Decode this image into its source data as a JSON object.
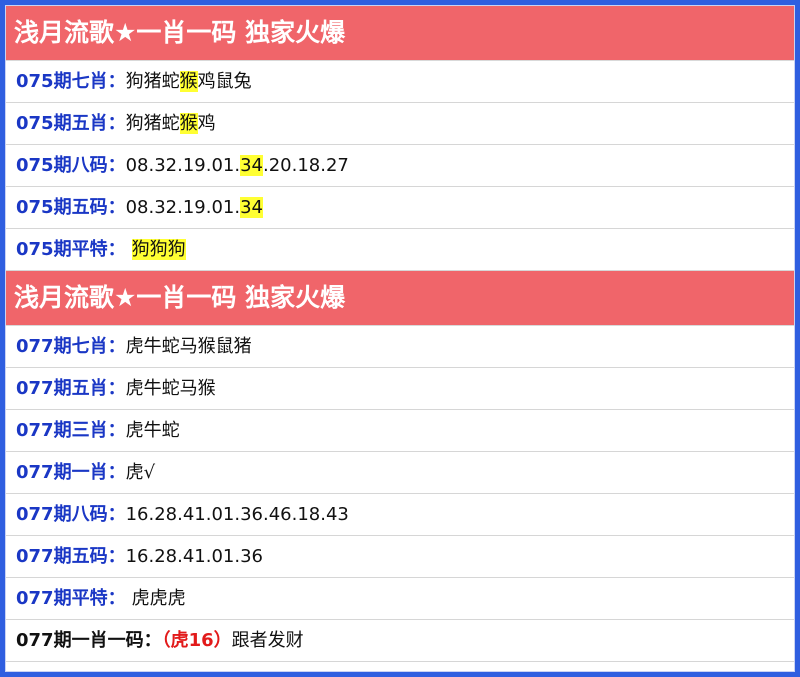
{
  "section1": {
    "header": "浅月流歌★一肖一码 独家火爆",
    "rows": [
      {
        "label": "075期七肖：",
        "pre": "狗猪蛇",
        "hl": "猴",
        "post": "鸡鼠兔"
      },
      {
        "label": "075期五肖：",
        "pre": "狗猪蛇",
        "hl": "猴",
        "post": "鸡"
      },
      {
        "label": "075期八码：",
        "pre": "08.32.19.01.",
        "hl": "34",
        "post": ".20.18.27"
      },
      {
        "label": "075期五码：",
        "pre": "08.32.19.01.",
        "hl": "34",
        "post": ""
      },
      {
        "label": "075期平特：",
        "pre": "",
        "hl": "狗狗狗",
        "post": ""
      }
    ]
  },
  "section2": {
    "header": "浅月流歌★一肖一码 独家火爆",
    "rows": [
      {
        "label": "077期七肖：",
        "value": "虎牛蛇马猴鼠猪"
      },
      {
        "label": "077期五肖：",
        "value": "虎牛蛇马猴"
      },
      {
        "label": "077期三肖：",
        "value": "虎牛蛇"
      },
      {
        "label": "077期一肖：",
        "value": "虎√"
      },
      {
        "label": "077期八码：",
        "value": "16.28.41.01.36.46.18.43"
      },
      {
        "label": "077期五码：",
        "value": "16.28.41.01.36"
      },
      {
        "label": "077期平特：",
        "value": "虎虎虎"
      }
    ],
    "final": {
      "label": "077期一肖一码：",
      "red": "（虎16）",
      "tail": "跟者发财"
    }
  },
  "colors": {
    "header_bg": "#f0656a",
    "label": "#1a37c5",
    "highlight": "#ffff33",
    "red": "#e21a1a",
    "border": "#2f5fe0"
  }
}
